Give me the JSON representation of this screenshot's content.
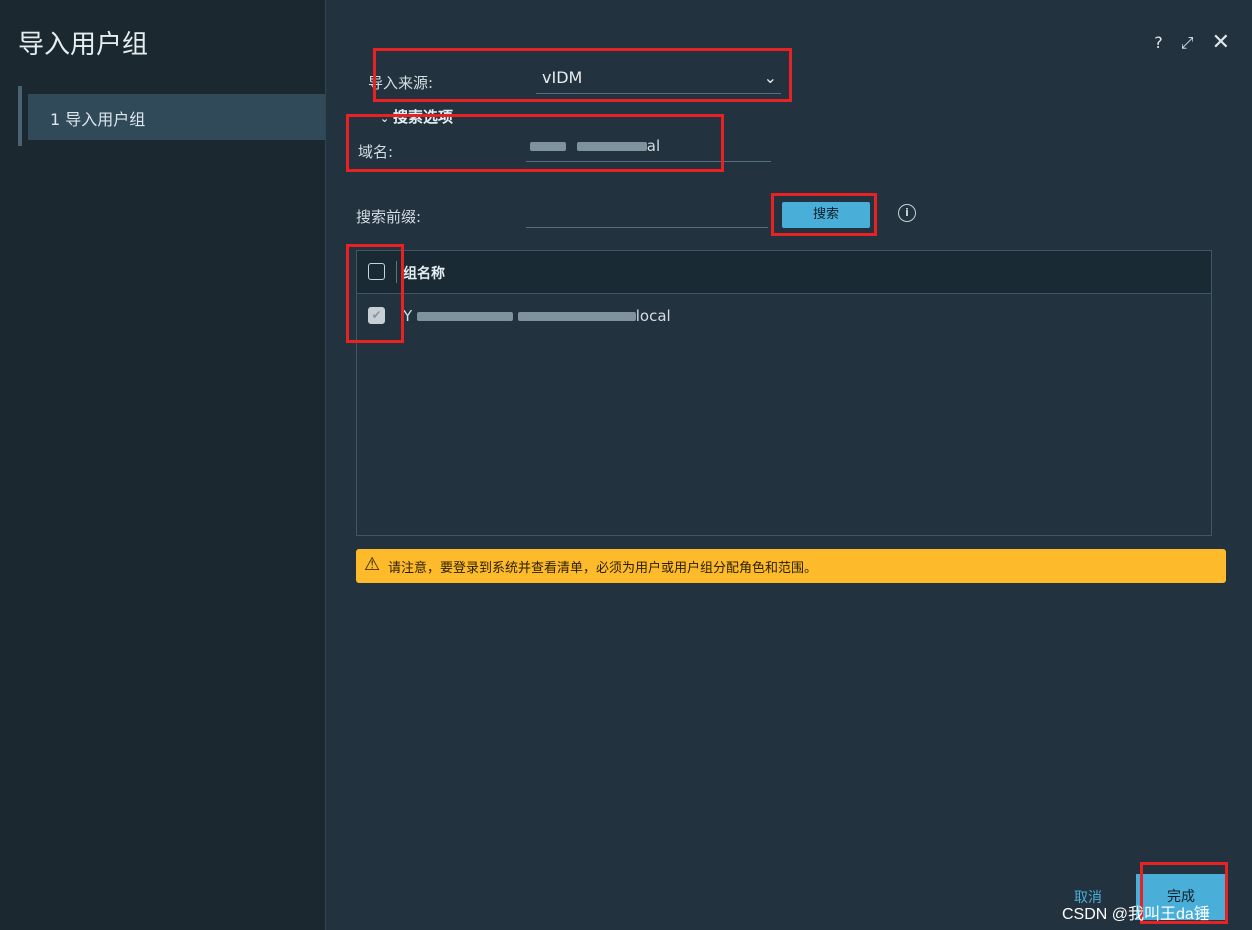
{
  "wizard": {
    "title": "导入用户组",
    "steps": [
      {
        "label": "1  导入用户组"
      }
    ]
  },
  "toolbar": {
    "help": "?",
    "expand": "⤢",
    "close": "✕"
  },
  "form": {
    "source_label": "导入来源:",
    "source_value": "vIDM",
    "section_title": "搜索选项",
    "domain_label": "域名:",
    "domain_value_tail": "al",
    "prefix_label": "搜索前缀:",
    "prefix_value": "",
    "search_button": "搜索"
  },
  "table": {
    "column": "组名称",
    "rows": [
      {
        "name_head": "Y",
        "name_tail": "local",
        "checked": true
      }
    ]
  },
  "alert": {
    "text": "请注意，要登录到系统并查看清单，必须为用户或用户组分配角色和范围。"
  },
  "footer": {
    "cancel": "取消",
    "finish": "完成"
  },
  "watermark": "CSDN @我叫王da锤",
  "colors": {
    "accent": "#49afd9",
    "warning": "#fdbb2c",
    "highlight": "#e82222"
  }
}
